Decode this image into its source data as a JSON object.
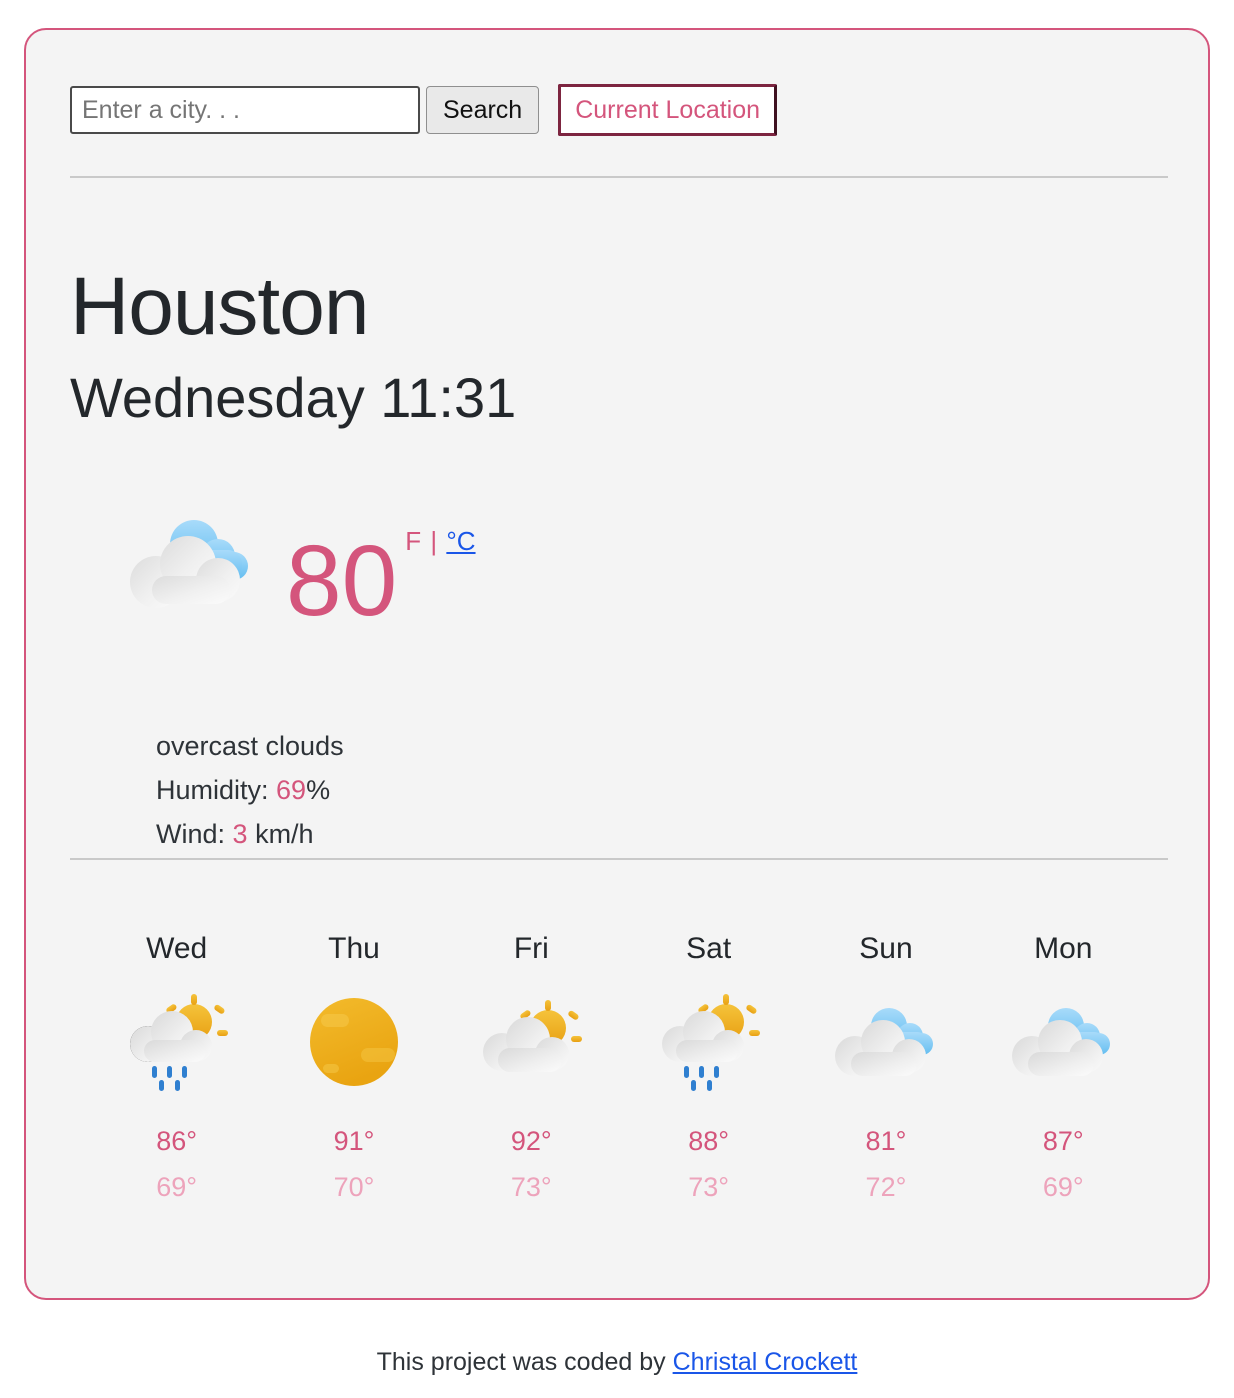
{
  "search": {
    "placeholder": "Enter a city. . .",
    "value": "",
    "search_label": "Search",
    "current_location_label": "Current Location"
  },
  "current": {
    "city": "Houston",
    "day_time": "Wednesday 11:31",
    "icon": "overcast-clouds-icon",
    "temperature": "80",
    "unit_fahrenheit": "F",
    "unit_separator": "|",
    "unit_celsius": "°C",
    "description": "overcast clouds",
    "humidity_label": "Humidity: ",
    "humidity_value": "69",
    "humidity_suffix": "%",
    "wind_label": "Wind: ",
    "wind_value": "3",
    "wind_suffix": " km/h"
  },
  "forecast": [
    {
      "day": "Wed",
      "icon": "sun-cloud-rain-icon",
      "high": "86°",
      "low": "69°"
    },
    {
      "day": "Thu",
      "icon": "sun-icon",
      "high": "91°",
      "low": "70°"
    },
    {
      "day": "Fri",
      "icon": "sun-cloud-icon",
      "high": "92°",
      "low": "73°"
    },
    {
      "day": "Sat",
      "icon": "sun-cloud-rain-icon",
      "high": "88°",
      "low": "73°"
    },
    {
      "day": "Sun",
      "icon": "overcast-clouds-icon",
      "high": "81°",
      "low": "72°"
    },
    {
      "day": "Mon",
      "icon": "overcast-clouds-icon",
      "high": "87°",
      "low": "69°"
    }
  ],
  "footer": {
    "text": "This project was coded by ",
    "author": "Christal Crockett"
  },
  "colors": {
    "accent_pink": "#d4557c",
    "accent_pink_light": "#eda3bb",
    "link_blue": "#1a56e8",
    "border_maroon": "#7d2540",
    "card_bg": "#f4f4f4",
    "text_dark": "#23272b",
    "sun_gold": "#efac1d",
    "cloud_blue": "#7cc5f2",
    "rain_blue": "#2f7fd0"
  }
}
